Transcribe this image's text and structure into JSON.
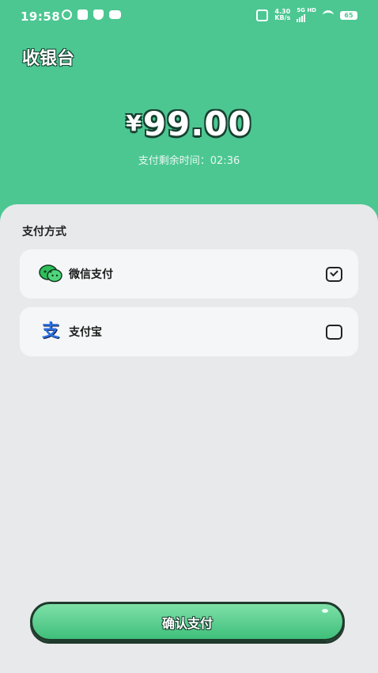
{
  "status_bar": {
    "time": "19:58",
    "net_speed_value": "4.30",
    "net_speed_unit": "KB/s",
    "network": "5G HD",
    "battery": "65",
    "icons": [
      "sync-icon",
      "bilibili-icon",
      "shield-icon",
      "chat-icon",
      "mute-icon",
      "signal-icon",
      "wifi-icon",
      "battery-icon"
    ]
  },
  "header": {
    "title": "收银台"
  },
  "payment": {
    "currency": "¥",
    "amount": "99.00",
    "countdown": "支付剩余时间：02:36"
  },
  "methods": {
    "section_title": "支付方式",
    "items": [
      {
        "label": "微信支付",
        "icon": "wechat-pay-icon",
        "selected": true
      },
      {
        "label": "支付宝",
        "icon": "alipay-icon",
        "icon_glyph": "支",
        "selected": false
      }
    ]
  },
  "confirm": {
    "label": "确认支付"
  },
  "colors": {
    "brand_green": "#4cc792",
    "sheet_bg": "#e8e9eb",
    "alipay_blue": "#2b6fe0"
  }
}
